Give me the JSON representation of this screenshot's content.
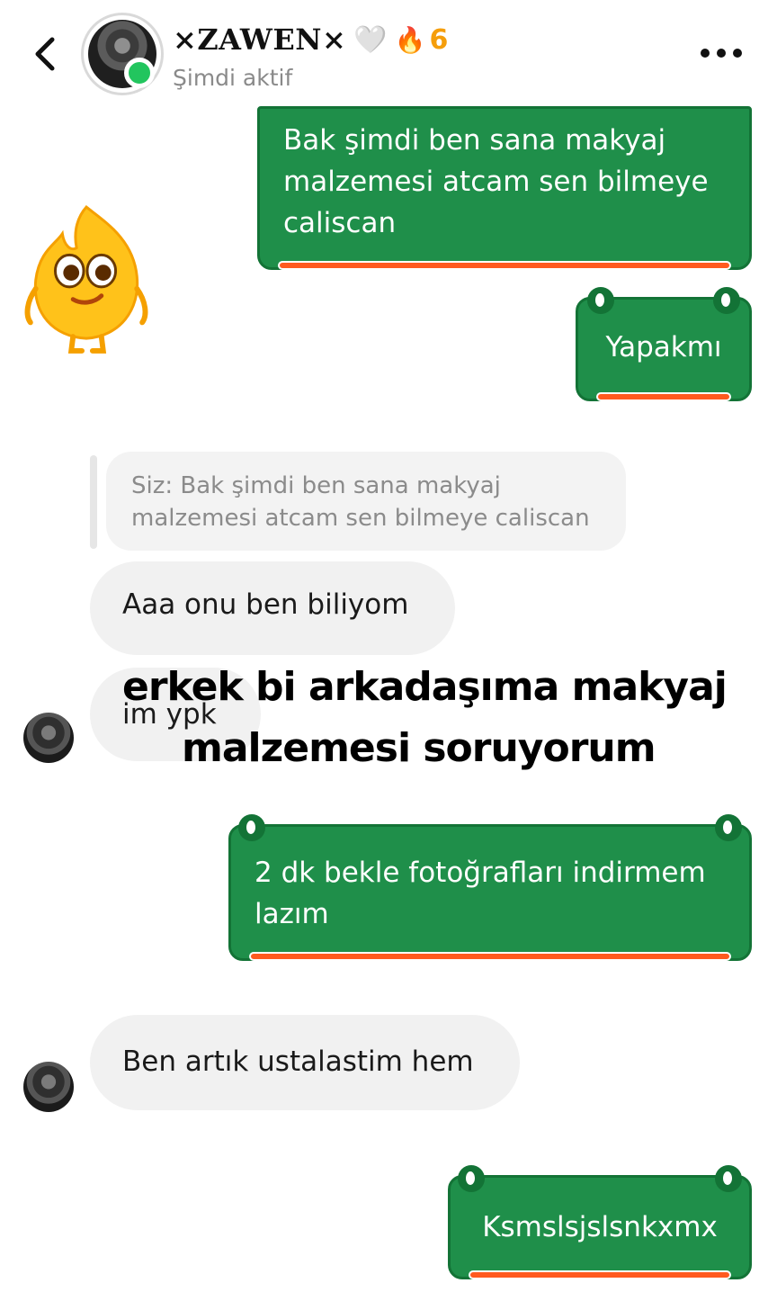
{
  "header": {
    "name": "×ZAWEN×",
    "heart": "🤍",
    "streak_icon": "🔥",
    "streak_count": "6",
    "status": "Şimdi aktif"
  },
  "sticker": {
    "icon": "yellow-fire-mascot-sticker"
  },
  "messages": {
    "out1": "Bak şimdi ben sana makyaj malzemesi atcam sen bilmeye caliscan",
    "out2": "Yapakmı",
    "reply_quote": "Siz: Bak şimdi ben sana makyaj malzemesi atcam sen bilmeye caliscan",
    "in1": "Aaa onu ben biliyom",
    "in2": "im ypk",
    "out3": "2 dk bekle fotoğrafları indirmem lazım",
    "in3": "Ben artık ustalastim hem",
    "out4": "Ksmslsjslsnkxmx"
  },
  "overlay": {
    "line1": "erkek bi arkadaşıma makyaj",
    "line2": "malzemesi soruyorum"
  },
  "colors": {
    "outgoing_bubble": "#1f8f4a",
    "outgoing_border": "#137336",
    "accent_bar": "#ff5a1f",
    "online_dot": "#22c55e",
    "incoming_bubble": "#f1f1f1"
  }
}
